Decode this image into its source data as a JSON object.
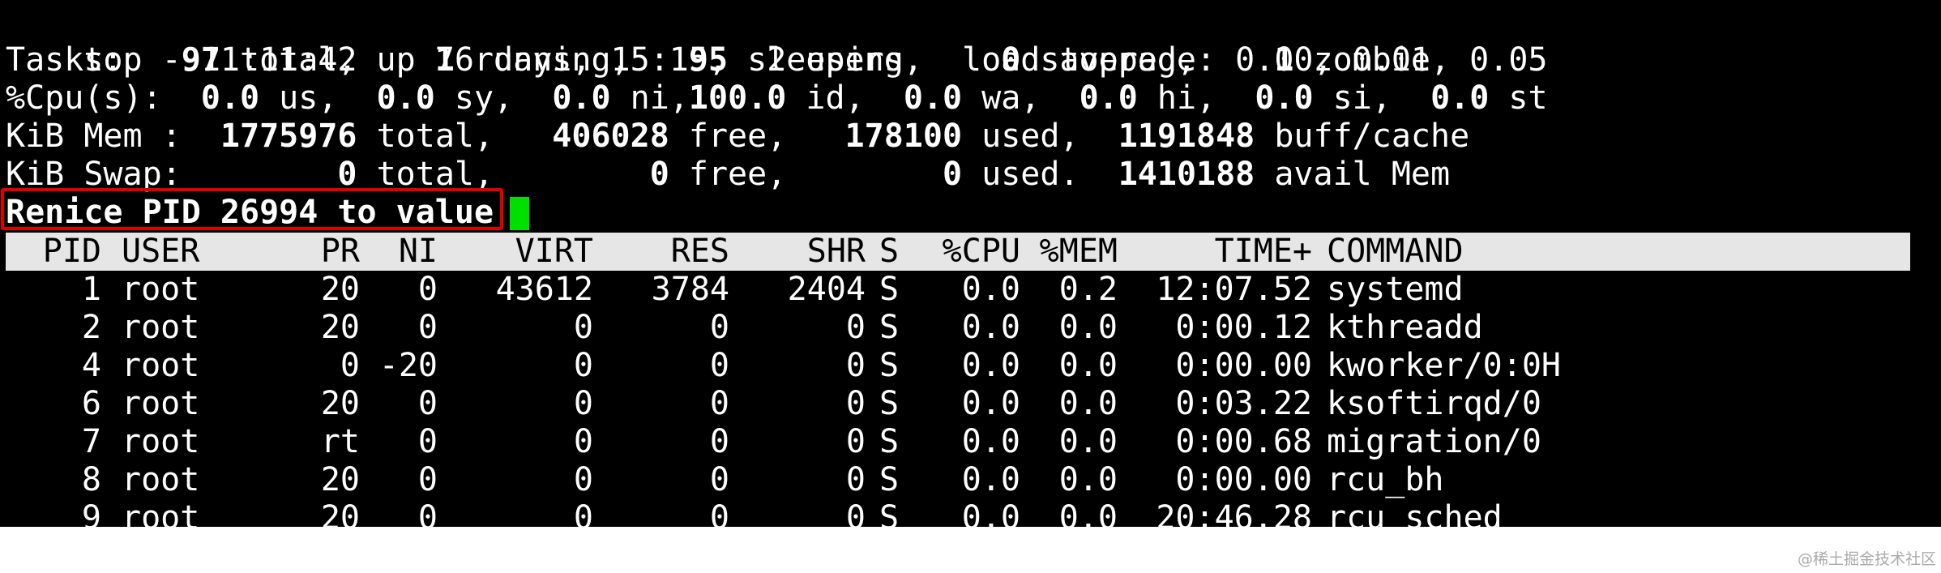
{
  "summary": {
    "uptime_line": "top - 11:11:42 up 76 days, 15:15,  2 users,  load average: 0.00, 0.01, 0.05",
    "tasks": {
      "label": "Tasks: ",
      "total": "  97",
      "total_label": " total, ",
      "running": "   1",
      "running_label": " running, ",
      "sleeping": "  95",
      "sleeping_label": " sleeping, ",
      "stopped": "   0",
      "stopped_label": " stopped, ",
      "zombie": "   1",
      "zombie_label": " zombie"
    },
    "cpu": {
      "label": "%Cpu(s): ",
      "us": " 0.0",
      "us_label": " us, ",
      "sy": " 0.0",
      "sy_label": " sy, ",
      "ni": " 0.0",
      "ni_label": " ni,",
      "id": "100.0",
      "id_label": " id, ",
      "wa": " 0.0",
      "wa_label": " wa, ",
      "hi": " 0.0",
      "hi_label": " hi, ",
      "si": " 0.0",
      "si_label": " si, ",
      "st": " 0.0",
      "st_label": " st"
    },
    "mem": {
      "label": "KiB Mem : ",
      "total": " 1775976",
      "total_label": " total, ",
      "free": "  406028",
      "free_label": " free, ",
      "used": "  178100",
      "used_label": " used, ",
      "cache": " 1191848",
      "cache_label": " buff/cache"
    },
    "swap": {
      "label": "KiB Swap: ",
      "total": "       0",
      "total_label": " total, ",
      "free": "       0",
      "free_label": " free, ",
      "used": "       0",
      "used_label": " used. ",
      "avail": " 1410188",
      "avail_label": " avail Mem"
    }
  },
  "prompt": {
    "text": "Renice PID 26994 to value",
    "input_value": "",
    "highlight_color": "#e00000",
    "cursor_color": "#00e000"
  },
  "table": {
    "headers": {
      "pid": "PID",
      "user": "USER",
      "pr": "PR",
      "ni": "NI",
      "virt": "VIRT",
      "res": "RES",
      "shr": "SHR",
      "s": "S",
      "cpu": "%CPU",
      "mem": "%MEM",
      "time": "TIME+",
      "command": "COMMAND"
    },
    "rows": [
      {
        "pid": "1",
        "user": "root",
        "pr": "20",
        "ni": "0",
        "virt": "43612",
        "res": "3784",
        "shr": "2404",
        "s": "S",
        "cpu": "0.0",
        "mem": "0.2",
        "time": "12:07.52",
        "command": "systemd"
      },
      {
        "pid": "2",
        "user": "root",
        "pr": "20",
        "ni": "0",
        "virt": "0",
        "res": "0",
        "shr": "0",
        "s": "S",
        "cpu": "0.0",
        "mem": "0.0",
        "time": "0:00.12",
        "command": "kthreadd"
      },
      {
        "pid": "4",
        "user": "root",
        "pr": "0",
        "ni": "-20",
        "virt": "0",
        "res": "0",
        "shr": "0",
        "s": "S",
        "cpu": "0.0",
        "mem": "0.0",
        "time": "0:00.00",
        "command": "kworker/0:0H"
      },
      {
        "pid": "6",
        "user": "root",
        "pr": "20",
        "ni": "0",
        "virt": "0",
        "res": "0",
        "shr": "0",
        "s": "S",
        "cpu": "0.0",
        "mem": "0.0",
        "time": "0:03.22",
        "command": "ksoftirqd/0"
      },
      {
        "pid": "7",
        "user": "root",
        "pr": "rt",
        "ni": "0",
        "virt": "0",
        "res": "0",
        "shr": "0",
        "s": "S",
        "cpu": "0.0",
        "mem": "0.0",
        "time": "0:00.68",
        "command": "migration/0"
      },
      {
        "pid": "8",
        "user": "root",
        "pr": "20",
        "ni": "0",
        "virt": "0",
        "res": "0",
        "shr": "0",
        "s": "S",
        "cpu": "0.0",
        "mem": "0.0",
        "time": "0:00.00",
        "command": "rcu_bh"
      },
      {
        "pid": "9",
        "user": "root",
        "pr": "20",
        "ni": "0",
        "virt": "0",
        "res": "0",
        "shr": "0",
        "s": "S",
        "cpu": "0.0",
        "mem": "0.0",
        "time": "20:46.28",
        "command": "rcu_sched"
      }
    ]
  },
  "watermark": "@稀土掘金技术社区"
}
